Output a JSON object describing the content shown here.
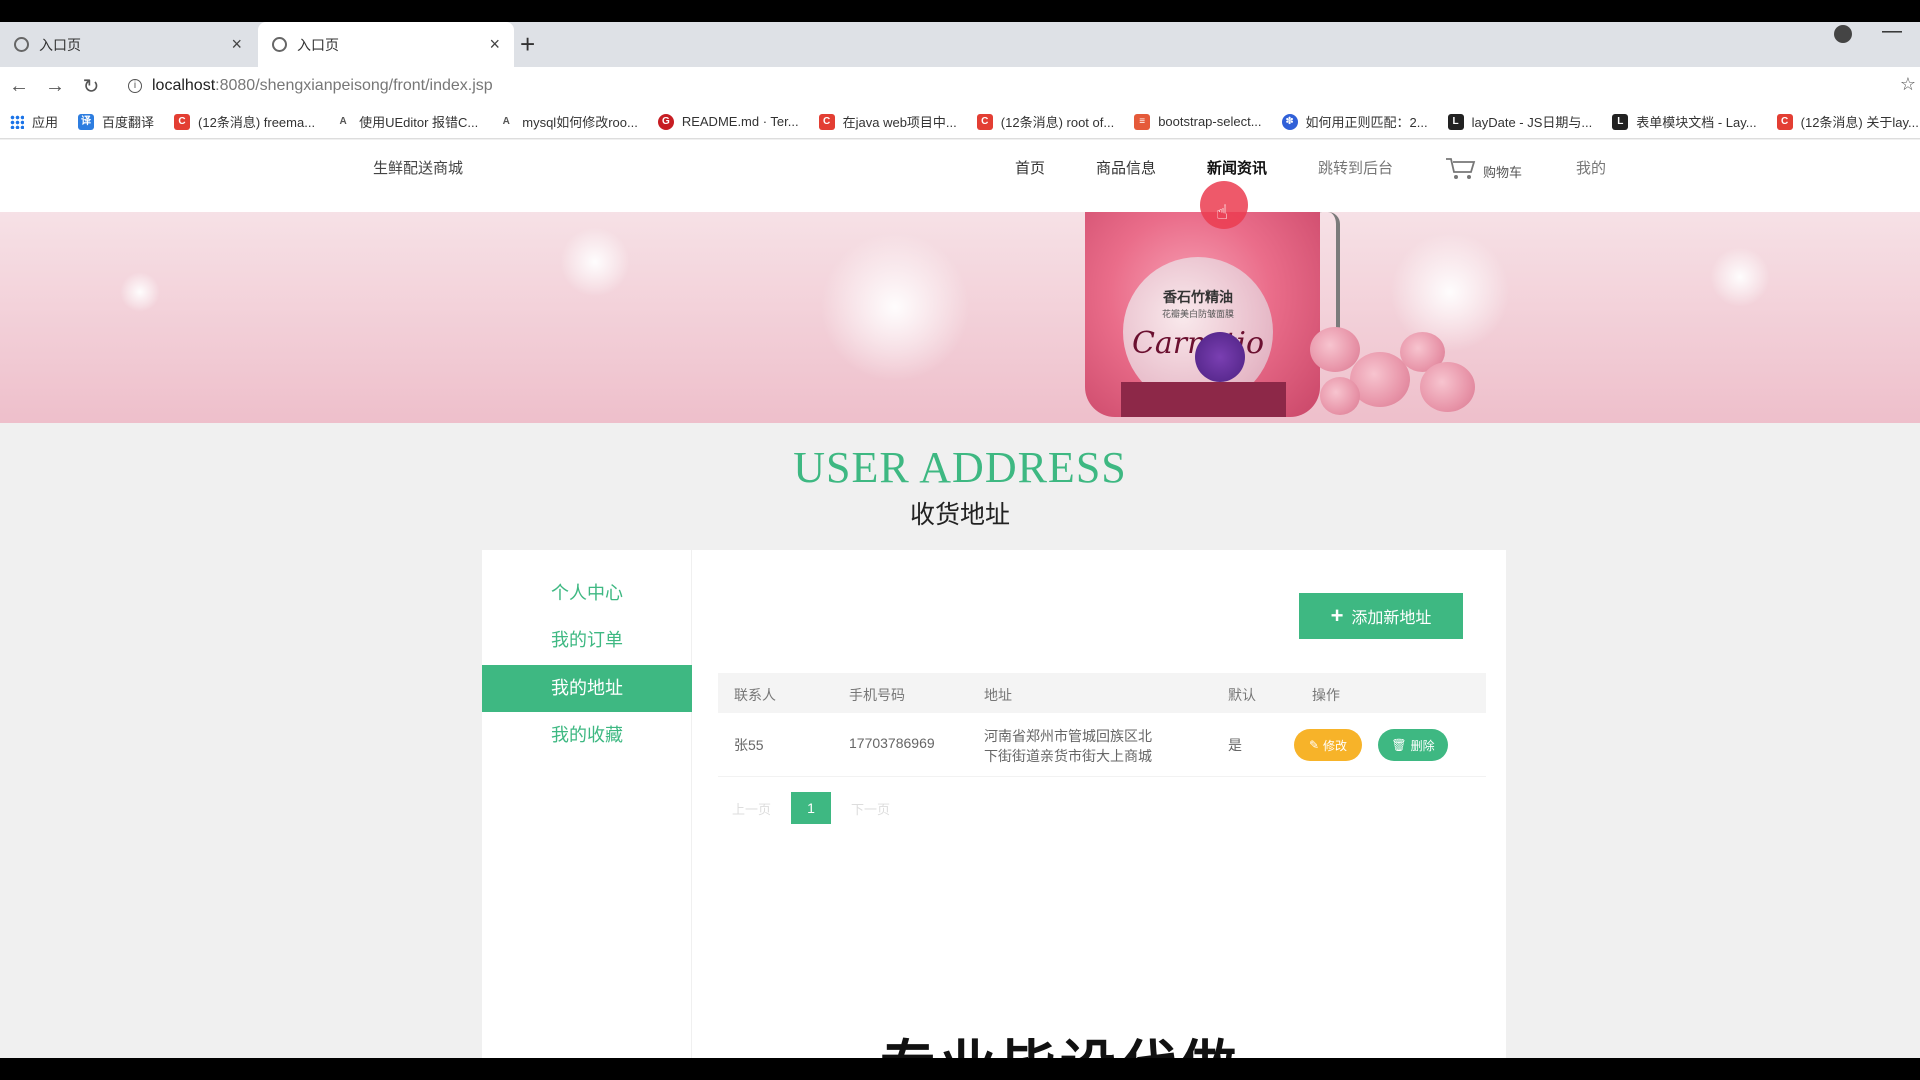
{
  "browser": {
    "tabs": [
      {
        "title": "入口页"
      },
      {
        "title": "入口页"
      }
    ],
    "url_host": "localhost",
    "url_rest": ":8080/shengxianpeisong/front/index.jsp",
    "bookmarks": [
      {
        "label": "应用",
        "icon": "apps-grid-icon"
      },
      {
        "label": "百度翻译",
        "icon": "baidu-translate-icon",
        "color": "#2d7de0"
      },
      {
        "label": "(12条消息) freema...",
        "icon": "csdn-icon",
        "color": "#e33e33"
      },
      {
        "label": "使用UEditor 报错C...",
        "icon": "page-icon",
        "color": "#555555"
      },
      {
        "label": "mysql如何修改roo...",
        "icon": "page-icon",
        "color": "#555555"
      },
      {
        "label": "README.md · Ter...",
        "icon": "gitee-icon",
        "color": "#c71d23"
      },
      {
        "label": "在java web项目中...",
        "icon": "csdn-icon",
        "color": "#e33e33"
      },
      {
        "label": "(12条消息) root of...",
        "icon": "csdn-icon",
        "color": "#e33e33"
      },
      {
        "label": "bootstrap-select...",
        "icon": "oschina-icon",
        "color": "#e55a3a"
      },
      {
        "label": "如何用正则匹配：2...",
        "icon": "baidu-paw-icon",
        "color": "#3060d8"
      },
      {
        "label": "layDate - JS日期与...",
        "icon": "layui-icon",
        "color": "#222222"
      },
      {
        "label": "表单模块文档 - Lay...",
        "icon": "layui-icon",
        "color": "#222222"
      },
      {
        "label": "(12条消息) 关于lay...",
        "icon": "csdn-icon",
        "color": "#e33e33"
      }
    ]
  },
  "site": {
    "logo": "生鲜配送商城",
    "nav": [
      "首页",
      "商品信息",
      "新闻资讯",
      "跳转到后台"
    ],
    "cart_label": "购物车",
    "me_label": "我的"
  },
  "banner": {
    "product_name": "香石竹精油",
    "product_sub": "花瓣美白防皱面膜",
    "brand": "Carnatio"
  },
  "section": {
    "title": "USER ADDRESS",
    "subtitle": "收货地址"
  },
  "sidebar": {
    "items": [
      {
        "label": "个人中心",
        "active": false
      },
      {
        "label": "我的订单",
        "active": false
      },
      {
        "label": "我的地址",
        "active": true
      },
      {
        "label": "我的收藏",
        "active": false
      }
    ]
  },
  "address": {
    "add_button": "添加新地址",
    "columns": [
      "联系人",
      "手机号码",
      "地址",
      "默认",
      "操作"
    ],
    "rows": [
      {
        "contact": "张55",
        "phone": "17703786969",
        "address": "河南省郑州市管城回族区北下街街道亲货市街大上商城",
        "default": "是",
        "edit": "修改",
        "delete": "删除"
      }
    ],
    "pager": {
      "prev": "上一页",
      "current": "1",
      "next": "下一页"
    }
  },
  "footer_text": "专业毕设代做",
  "colors": {
    "accent": "#3eb882",
    "edit": "#f7b329",
    "cursor": "#eb3c50"
  }
}
